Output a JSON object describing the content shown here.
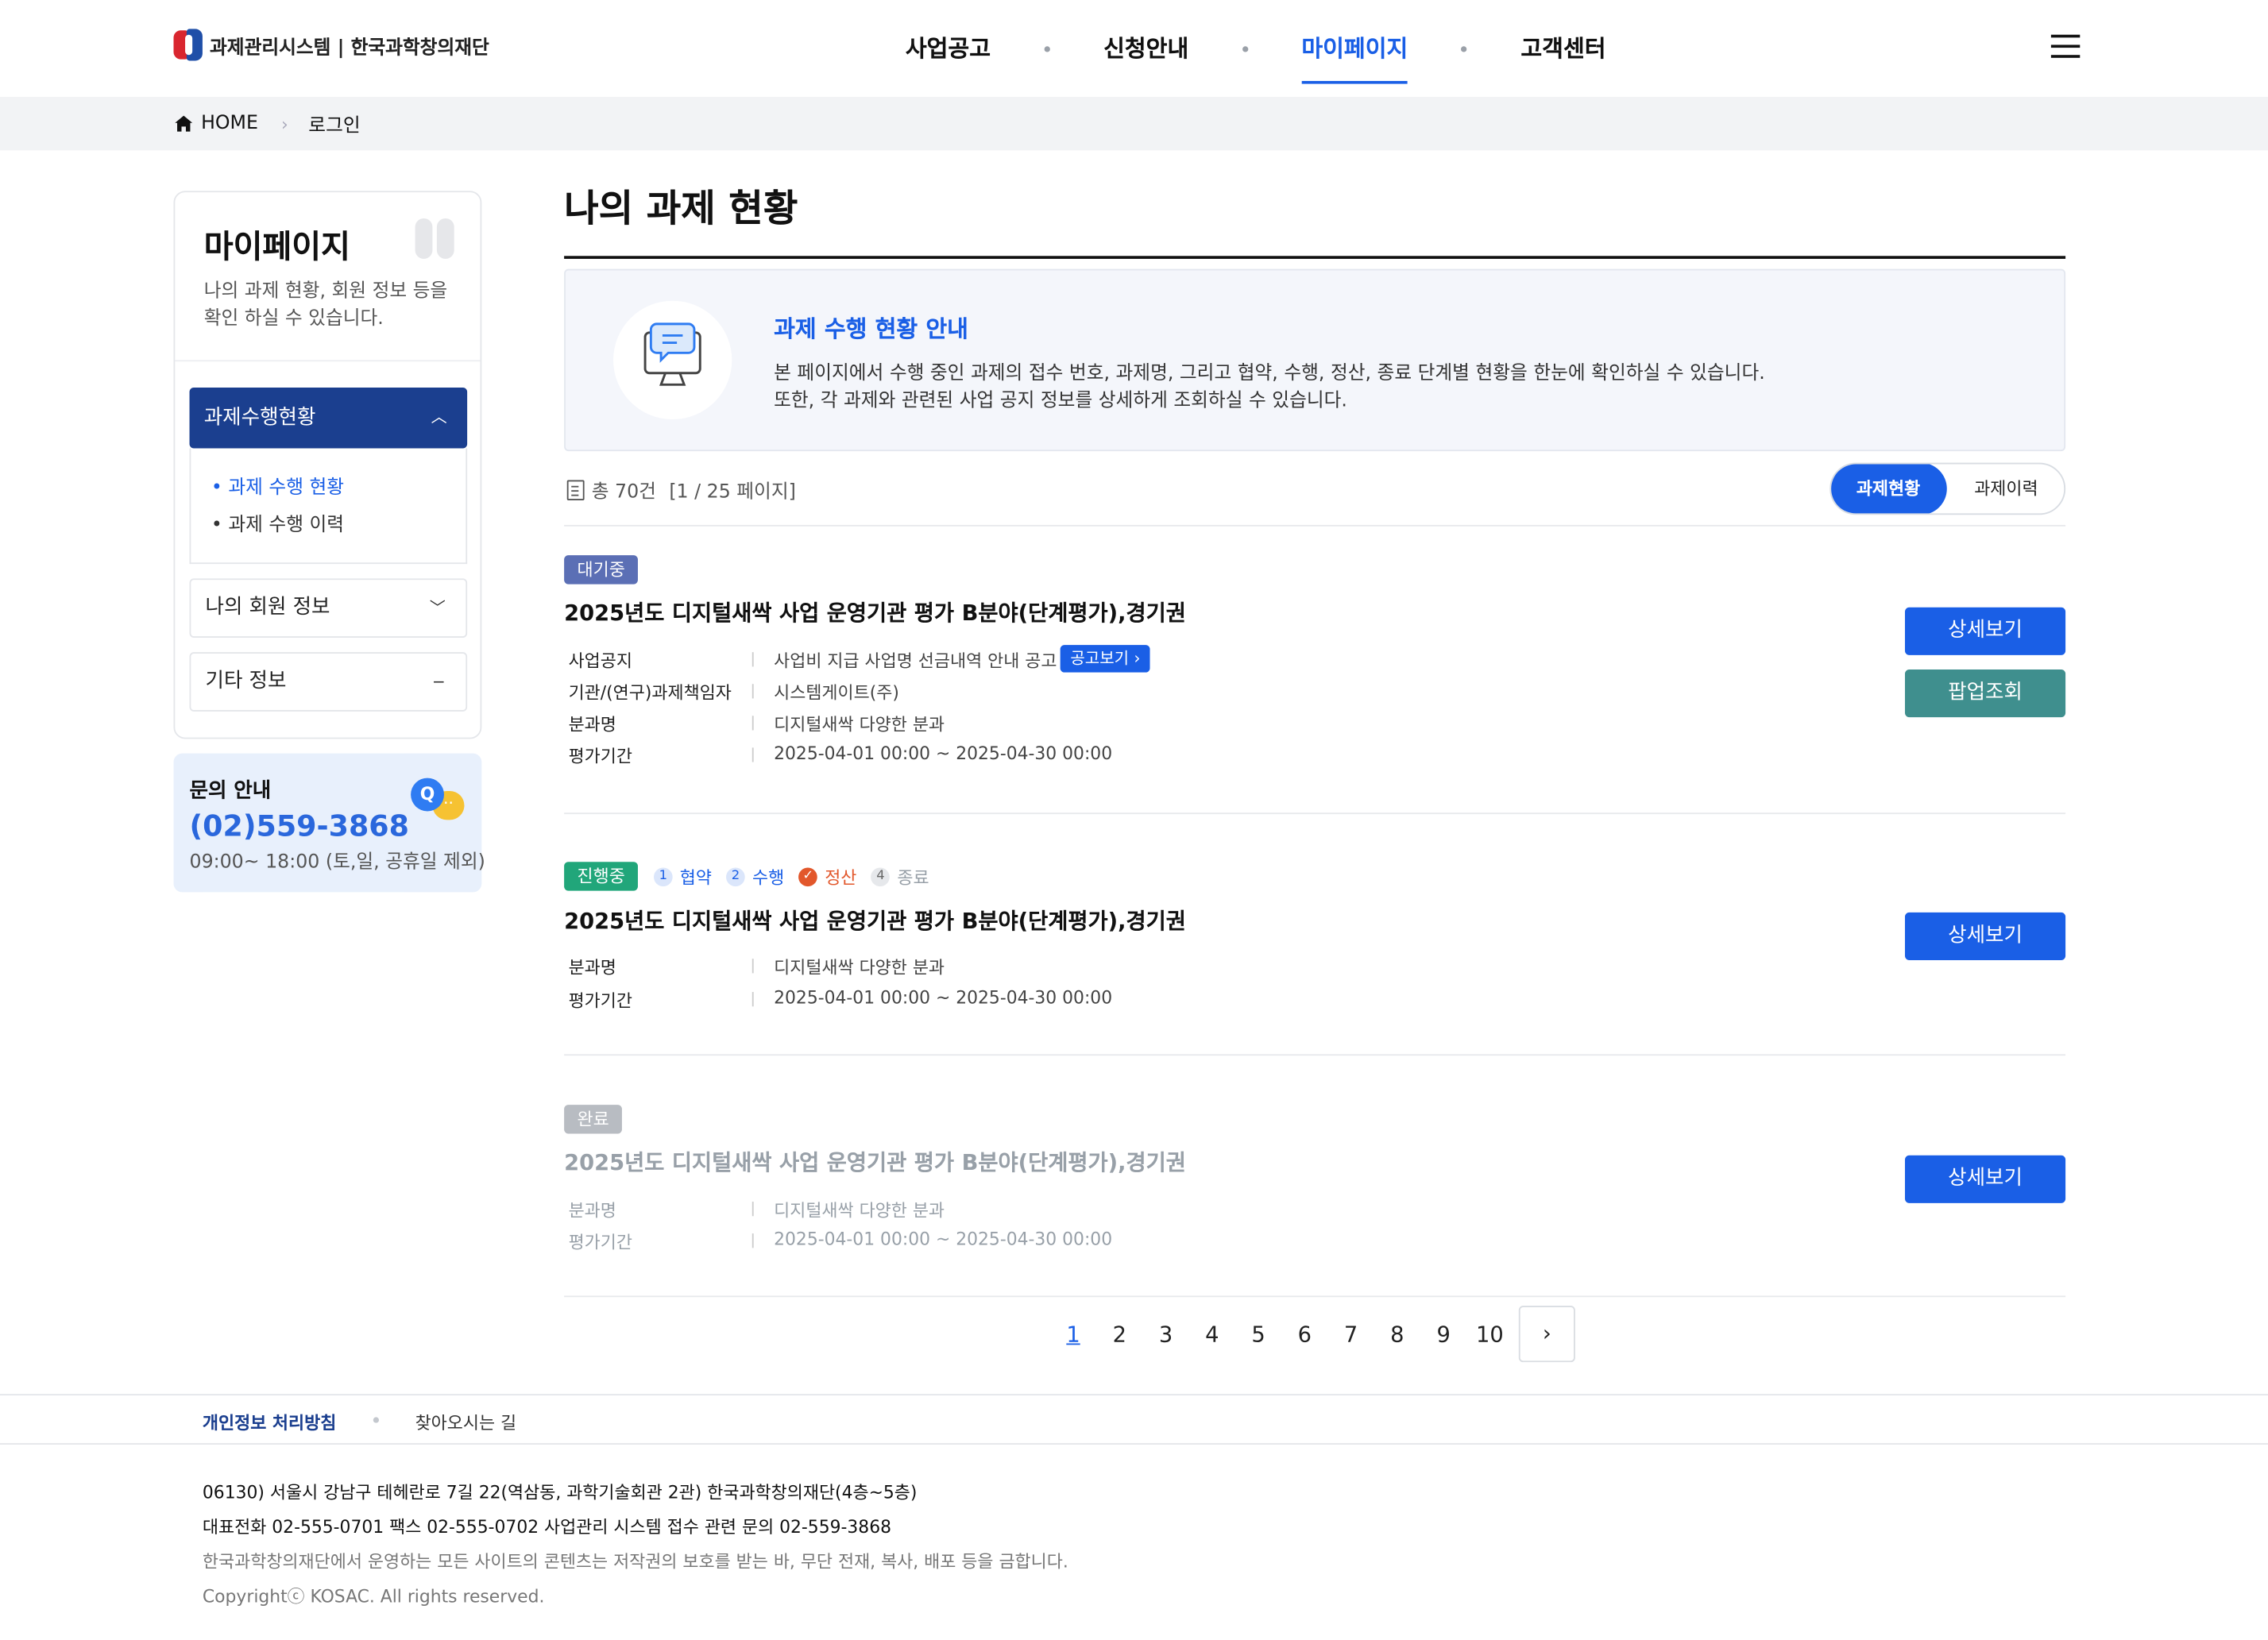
{
  "header": {
    "logo_text": "과제관리시스템 | 한국과학창의재단",
    "nav": [
      "사업공고",
      "신청안내",
      "마이페이지",
      "고객센터"
    ],
    "active_nav": "마이페이지"
  },
  "breadcrumb": {
    "home": "HOME",
    "current": "로그인"
  },
  "sidebar": {
    "title": "마이페이지",
    "desc": "나의 과제 현황, 회원 정보 등을 확인 하실 수 있습니다.",
    "menu_open": "과제수행현황",
    "sub_items": [
      "과제 수행 현황",
      "과제 수행 이력"
    ],
    "menu_items": [
      "나의 회원 정보",
      "기타 정보"
    ],
    "contact": {
      "title": "문의 안내",
      "phone": "(02)559-3868",
      "hours": "09:00~ 18:00 (토,일, 공휴일 제외)"
    }
  },
  "main": {
    "title": "나의 과제 현황",
    "info": {
      "title": "과제 수행 현황 안내",
      "line1": "본 페이지에서 수행 중인 과제의 접수 번호, 과제명, 그리고 협약, 수행, 정산, 종료 단계별 현황을 한눈에 확인하실 수 있습니다.",
      "line2": "또한, 각 과제와 관련된 사업 공지 정보를 상세하게 조회하실 수 있습니다."
    },
    "count_text": "총 70건",
    "page_text": "[1 / 25 페이지]",
    "toggle": {
      "active": "과제현황",
      "inactive": "과제이력"
    },
    "projects": [
      {
        "status": "대기중",
        "status_color": "#5b6fb5",
        "title": "2025년도 디지털새싹 사업 운영기관 평가 B분야(단계평가),경기권",
        "rows": [
          {
            "label": "사업공지",
            "value": "사업비 지급 사업명 선금내역 안내 공고"
          },
          {
            "label": "기관/(연구)과제책임자",
            "value": "시스템게이트(주)"
          },
          {
            "label": "분과명",
            "value": "디지털새싹 다양한 분과"
          },
          {
            "label": "평가기간",
            "value": "2025-04-01 00:00 ~ 2025-04-30 00:00"
          }
        ],
        "notice_button": "공고보기 ›",
        "buttons": [
          "상세보기",
          "팝업조회"
        ]
      },
      {
        "status": "진행중",
        "status_color": "#21a67a",
        "steps": [
          {
            "num": "1",
            "label": "협약"
          },
          {
            "num": "2",
            "label": "수행"
          },
          {
            "num": "✓",
            "label": "정산"
          },
          {
            "num": "4",
            "label": "종료"
          }
        ],
        "title": "2025년도 디지털새싹 사업 운영기관 평가 B분야(단계평가),경기권",
        "rows": [
          {
            "label": "분과명",
            "value": "디지털새싹 다양한 분과"
          },
          {
            "label": "평가기간",
            "value": "2025-04-01 00:00 ~ 2025-04-30 00:00"
          }
        ],
        "buttons": [
          "상세보기"
        ]
      },
      {
        "status": "완료",
        "status_color": "#b8bcc2",
        "title": "2025년도 디지털새싹 사업 운영기관 평가 B분야(단계평가),경기권",
        "rows": [
          {
            "label": "분과명",
            "value": "디지털새싹 다양한 분과"
          },
          {
            "label": "평가기간",
            "value": "2025-04-01 00:00 ~ 2025-04-30 00:00"
          }
        ],
        "buttons": [
          "상세보기"
        ]
      }
    ],
    "pagination": {
      "pages": [
        "1",
        "2",
        "3",
        "4",
        "5",
        "6",
        "7",
        "8",
        "9",
        "10"
      ],
      "current": "1",
      "next": "›"
    }
  },
  "footer": {
    "links": [
      "개인정보 처리방침",
      "찾아오시는 길"
    ],
    "address": "06130) 서울시 강남구 테헤란로 7길 22(역삼동, 과학기술회관 2관) 한국과학창의재단(4층~5층)",
    "phone": "대표전화 02-555-0701 팩스 02-555-0702 사업관리 시스템 접수 관련 문의 02-559-3868",
    "notice": "한국과학창의재단에서 운영하는 모든 사이트의 콘텐츠는 저작권의 보호를 받는 바, 무단 전재, 복사, 배포 등을 금합니다.",
    "copyright": "Copyrightⓒ KOSAC. All rights reserved."
  }
}
